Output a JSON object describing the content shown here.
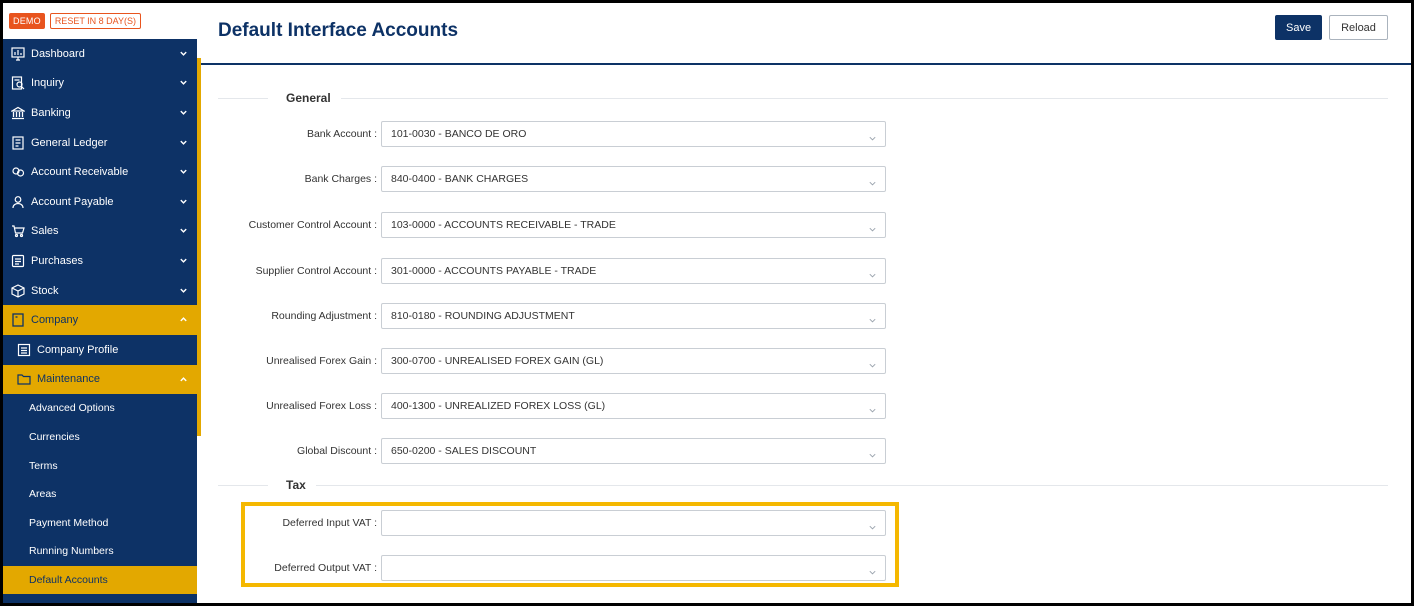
{
  "brand": {
    "demo_label": "DEMO",
    "reset_label": "RESET IN 8 DAY(S)"
  },
  "sidebar": {
    "items": [
      {
        "label": "Dashboard",
        "icon": "dashboard-icon"
      },
      {
        "label": "Inquiry",
        "icon": "inquiry-icon"
      },
      {
        "label": "Banking",
        "icon": "bank-icon"
      },
      {
        "label": "General Ledger",
        "icon": "ledger-icon"
      },
      {
        "label": "Account Receivable",
        "icon": "receivable-icon"
      },
      {
        "label": "Account Payable",
        "icon": "payable-icon"
      },
      {
        "label": "Sales",
        "icon": "sales-icon"
      },
      {
        "label": "Purchases",
        "icon": "purchases-icon"
      },
      {
        "label": "Stock",
        "icon": "stock-icon"
      },
      {
        "label": "Company",
        "icon": "company-icon"
      }
    ],
    "company_sub": {
      "profile_label": "Company Profile",
      "maintenance_label": "Maintenance"
    },
    "maintenance_items": [
      {
        "label": "Advanced Options"
      },
      {
        "label": "Currencies"
      },
      {
        "label": "Terms"
      },
      {
        "label": "Areas"
      },
      {
        "label": "Payment Method"
      },
      {
        "label": "Running Numbers"
      },
      {
        "label": "Default Accounts"
      }
    ]
  },
  "header": {
    "title": "Default Interface Accounts",
    "save_label": "Save",
    "reload_label": "Reload"
  },
  "general": {
    "title": "General",
    "fields": [
      {
        "label": "Bank Account :",
        "value": "101-0030 - BANCO DE ORO"
      },
      {
        "label": "Bank Charges :",
        "value": "840-0400 - BANK CHARGES"
      },
      {
        "label": "Customer Control Account :",
        "value": "103-0000 - ACCOUNTS RECEIVABLE - TRADE"
      },
      {
        "label": "Supplier Control Account :",
        "value": "301-0000 - ACCOUNTS PAYABLE - TRADE"
      },
      {
        "label": "Rounding Adjustment :",
        "value": "810-0180 - ROUNDING ADJUSTMENT"
      },
      {
        "label": "Unrealised Forex Gain :",
        "value": "300-0700 - UNREALISED FOREX GAIN (GL)"
      },
      {
        "label": "Unrealised Forex Loss :",
        "value": "400-1300 - UNREALIZED FOREX LOSS (GL)"
      },
      {
        "label": "Global Discount :",
        "value": "650-0200 - SALES DISCOUNT"
      }
    ]
  },
  "tax": {
    "title": "Tax",
    "fields": [
      {
        "label": "Deferred Input VAT :",
        "value": ""
      },
      {
        "label": "Deferred Output VAT :",
        "value": ""
      }
    ]
  },
  "colors": {
    "primary": "#0d3266",
    "accent": "#e3a800",
    "highlight": "#f5b800",
    "demo": "#e8541e"
  }
}
